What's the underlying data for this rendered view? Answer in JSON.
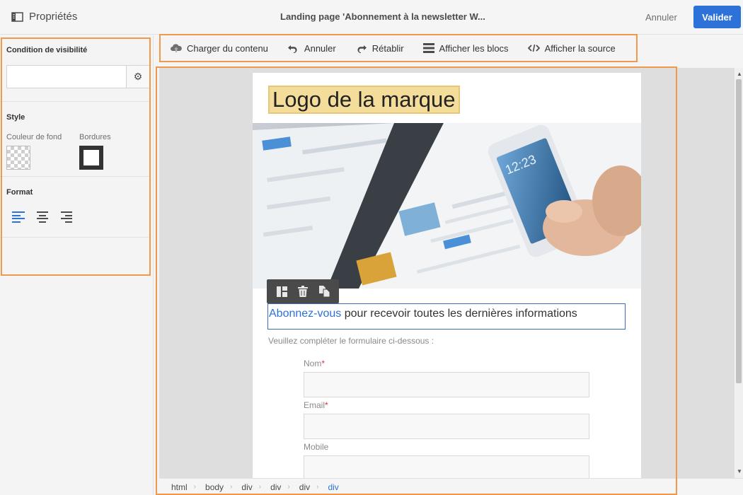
{
  "topbar": {
    "properties_label": "Propriétés",
    "title": "Landing page 'Abonnement à la newsletter W...",
    "cancel_label": "Annuler",
    "validate_label": "Valider"
  },
  "left_panel": {
    "visibility_title": "Condition de visibilité",
    "visibility_value": "",
    "style_title": "Style",
    "bg_color_label": "Couleur de fond",
    "borders_label": "Bordures",
    "format_title": "Format"
  },
  "toolbar": {
    "load_content": "Charger du contenu",
    "undo": "Annuler",
    "redo": "Rétablir",
    "show_blocks": "Afficher les blocs",
    "show_source": "Afficher la source"
  },
  "page": {
    "logo_text": "Logo de la marque",
    "headline_link": "Abonnez-vous",
    "headline_rest": " pour recevoir toutes les dernières informations",
    "subtext": "Veuillez compléter le formulaire ci-dessous :",
    "fields": [
      {
        "label": "Nom",
        "required": "*",
        "value": ""
      },
      {
        "label": "Email",
        "required": "*",
        "value": ""
      },
      {
        "label": "Mobile",
        "required": "",
        "value": ""
      }
    ]
  },
  "breadcrumb": [
    "html",
    "body",
    "div",
    "div",
    "div",
    "div"
  ],
  "colors": {
    "accent": "#2d72d9",
    "highlight": "#f0994a",
    "logo_bg": "#f4dd9a",
    "required": "#d7373f"
  }
}
